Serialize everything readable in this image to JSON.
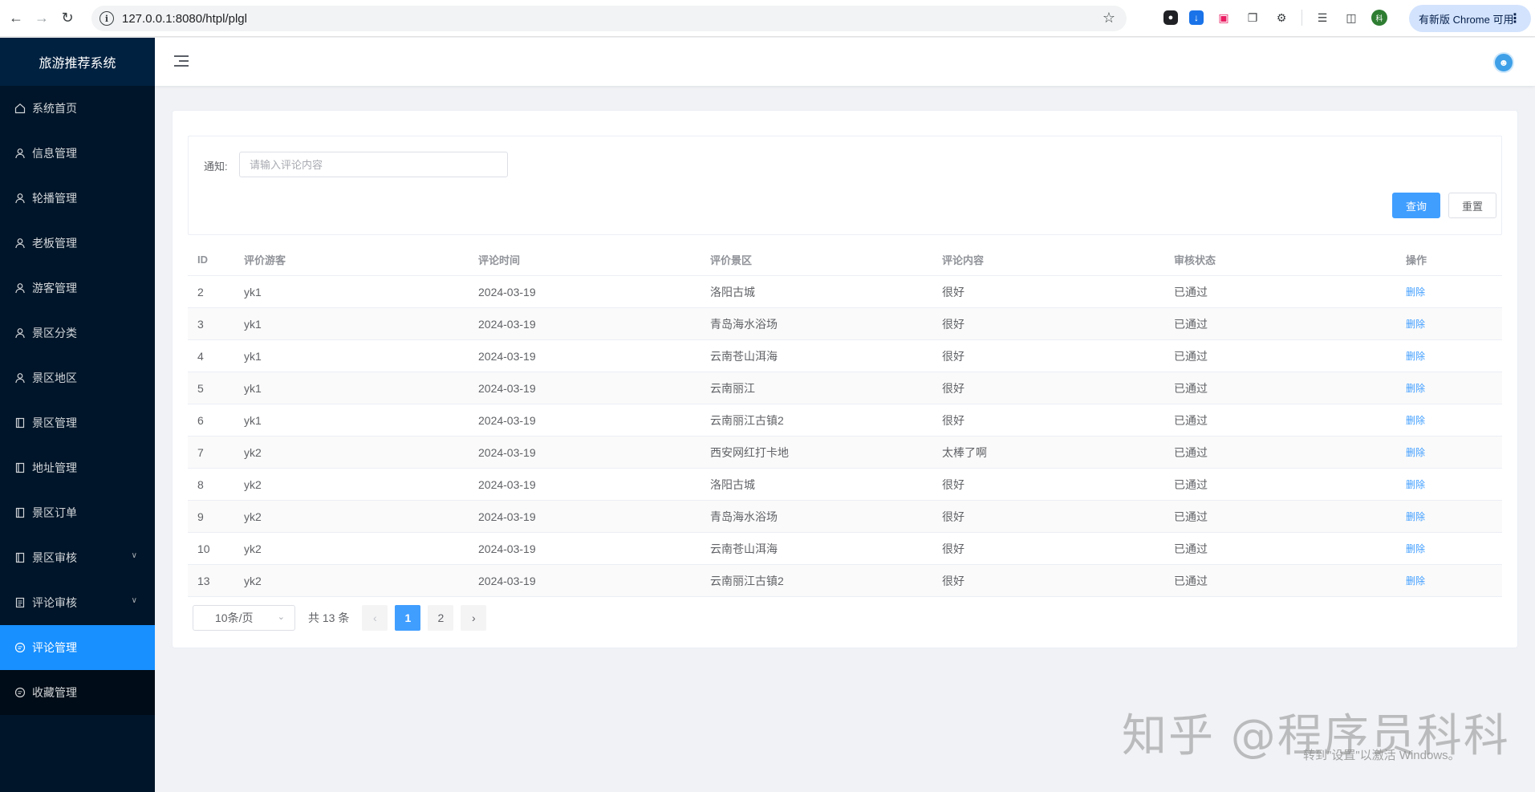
{
  "browser": {
    "url": "127.0.0.1:8080/htpl/plgl",
    "update_label": "有新版 Chrome 可用",
    "profile_initial": "科"
  },
  "app": {
    "title": "旅游推荐系统"
  },
  "sidebar": {
    "items": [
      {
        "label": "系统首页",
        "icon": "home-icon"
      },
      {
        "label": "信息管理",
        "icon": "user-icon"
      },
      {
        "label": "轮播管理",
        "icon": "user-icon"
      },
      {
        "label": "老板管理",
        "icon": "user-icon"
      },
      {
        "label": "游客管理",
        "icon": "user-icon"
      },
      {
        "label": "景区分类",
        "icon": "user-icon"
      },
      {
        "label": "景区地区",
        "icon": "user-icon"
      },
      {
        "label": "景区管理",
        "icon": "document-icon"
      },
      {
        "label": "地址管理",
        "icon": "document-icon"
      },
      {
        "label": "景区订单",
        "icon": "document-icon"
      },
      {
        "label": "景区审核",
        "icon": "document-icon"
      },
      {
        "label": "评论审核",
        "icon": "list-icon"
      },
      {
        "label": "评论管理",
        "icon": "chat-icon"
      },
      {
        "label": "收藏管理",
        "icon": "chat-icon"
      }
    ]
  },
  "search": {
    "label": "通知:",
    "placeholder": "请输入评论内容",
    "query_label": "查询",
    "reset_label": "重置"
  },
  "table": {
    "headers": [
      "ID",
      "评价游客",
      "评论时间",
      "评价景区",
      "评论内容",
      "审核状态",
      "操作"
    ],
    "rows": [
      {
        "id": "2",
        "visitor": "yk1",
        "time": "2024-03-19",
        "spot": "洛阳古城",
        "content": "很好",
        "status": "已通过",
        "action": "删除"
      },
      {
        "id": "3",
        "visitor": "yk1",
        "time": "2024-03-19",
        "spot": "青岛海水浴场",
        "content": "很好",
        "status": "已通过",
        "action": "删除"
      },
      {
        "id": "4",
        "visitor": "yk1",
        "time": "2024-03-19",
        "spot": "云南苍山洱海",
        "content": "很好",
        "status": "已通过",
        "action": "删除"
      },
      {
        "id": "5",
        "visitor": "yk1",
        "time": "2024-03-19",
        "spot": "云南丽江",
        "content": "很好",
        "status": "已通过",
        "action": "删除"
      },
      {
        "id": "6",
        "visitor": "yk1",
        "time": "2024-03-19",
        "spot": "云南丽江古镇2",
        "content": "很好",
        "status": "已通过",
        "action": "删除"
      },
      {
        "id": "7",
        "visitor": "yk2",
        "time": "2024-03-19",
        "spot": "西安网红打卡地",
        "content": "太棒了啊",
        "status": "已通过",
        "action": "删除"
      },
      {
        "id": "8",
        "visitor": "yk2",
        "time": "2024-03-19",
        "spot": "洛阳古城",
        "content": "很好",
        "status": "已通过",
        "action": "删除"
      },
      {
        "id": "9",
        "visitor": "yk2",
        "time": "2024-03-19",
        "spot": "青岛海水浴场",
        "content": "很好",
        "status": "已通过",
        "action": "删除"
      },
      {
        "id": "10",
        "visitor": "yk2",
        "time": "2024-03-19",
        "spot": "云南苍山洱海",
        "content": "很好",
        "status": "已通过",
        "action": "删除"
      },
      {
        "id": "13",
        "visitor": "yk2",
        "time": "2024-03-19",
        "spot": "云南丽江古镇2",
        "content": "很好",
        "status": "已通过",
        "action": "删除"
      }
    ]
  },
  "pagination": {
    "page_size": "10条/页",
    "total": "共 13 条",
    "pages": [
      "1",
      "2"
    ],
    "current": "1"
  },
  "watermark": {
    "text": "知乎 @程序员科科",
    "activate": "转到\"设置\"以激活 Windows。"
  },
  "colors": {
    "sidebar_bg": "#001529",
    "active_menu": "#1890ff",
    "primary": "#409eff"
  }
}
